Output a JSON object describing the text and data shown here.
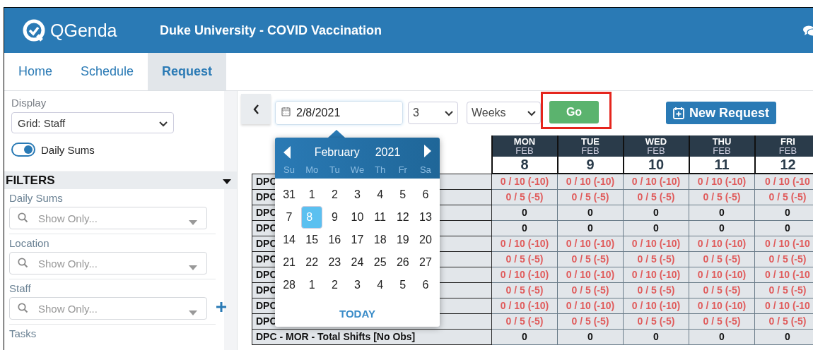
{
  "header": {
    "logo": "QGenda",
    "title": "Duke University - COVID Vaccination"
  },
  "nav": [
    {
      "label": "Home",
      "selected": false
    },
    {
      "label": "Schedule",
      "selected": false
    },
    {
      "label": "Request",
      "selected": true
    }
  ],
  "sidebar": {
    "display_label": "Display",
    "display_value": "Grid: Staff",
    "toggle": {
      "label": "Daily Sums",
      "on": true
    },
    "filters_title": "FILTERS",
    "filters": [
      {
        "label": "Daily Sums",
        "placeholder": "Show Only...",
        "add": false
      },
      {
        "label": "Location",
        "placeholder": "Show Only...",
        "add": false
      },
      {
        "label": "Staff",
        "placeholder": "Show Only...",
        "add": true
      }
    ],
    "tasks_label": "Tasks"
  },
  "toolbar": {
    "date": "2/8/2021",
    "count": "3",
    "unit": "Weeks",
    "go": "Go",
    "go_highlighted": true,
    "new_request": "New Request"
  },
  "grid": {
    "columns": [
      {
        "day": "MON",
        "month": "FEB",
        "date": "8"
      },
      {
        "day": "TUE",
        "month": "FEB",
        "date": "9"
      },
      {
        "day": "WED",
        "month": "FEB",
        "date": "10"
      },
      {
        "day": "THU",
        "month": "FEB",
        "date": "11"
      },
      {
        "day": "FRI",
        "month": "FEB",
        "date": "12"
      }
    ],
    "rows": [
      {
        "label": "DPC",
        "shortage": true,
        "cells": [
          "0 / 10 (-10)",
          "0 / 10 (-10)",
          "0 / 10 (-10)",
          "0 / 10 (-10)",
          "0 / 10 (-10"
        ]
      },
      {
        "label": "DPC",
        "shortage": true,
        "cells": [
          "0 / 5 (-5)",
          "0 / 5 (-5)",
          "0 / 5 (-5)",
          "0 / 5 (-5)",
          "0 / 5 (-5)"
        ]
      },
      {
        "label": "DPC",
        "shortage": false,
        "cells": [
          "0",
          "0",
          "0",
          "0",
          "0"
        ]
      },
      {
        "label": "DPC",
        "shortage": false,
        "cells": [
          "0",
          "0",
          "0",
          "0",
          "0"
        ]
      },
      {
        "label": "DPC",
        "shortage": true,
        "cells": [
          "0 / 10 (-10)",
          "0 / 10 (-10)",
          "0 / 10 (-10)",
          "0 / 10 (-10)",
          "0 / 10 (-10"
        ]
      },
      {
        "label": "DPC",
        "shortage": true,
        "cells": [
          "0 / 5 (-5)",
          "0 / 5 (-5)",
          "0 / 5 (-5)",
          "0 / 5 (-5)",
          "0 / 5 (-5)"
        ]
      },
      {
        "label": "DPC",
        "shortage": true,
        "cells": [
          "0 / 10 (-10)",
          "0 / 10 (-10)",
          "0 / 10 (-10)",
          "0 / 10 (-10)",
          "0 / 10 (-10"
        ]
      },
      {
        "label": "DPC",
        "shortage": true,
        "cells": [
          "0 / 5 (-5)",
          "0 / 5 (-5)",
          "0 / 5 (-5)",
          "0 / 5 (-5)",
          "0 / 5 (-5)"
        ]
      },
      {
        "label": "DPC",
        "shortage": true,
        "cells": [
          "0 / 10 (-10)",
          "0 / 10 (-10)",
          "0 / 10 (-10)",
          "0 / 10 (-10)",
          "0 / 10 (-10"
        ]
      },
      {
        "label": "DPC",
        "shortage": true,
        "cells": [
          "0 / 5 (-5)",
          "0 / 5 (-5)",
          "0 / 5 (-5)",
          "0 / 5 (-5)",
          "0 / 5 (-5)"
        ]
      },
      {
        "label": "DPC - MOR - Total Shifts [No Obs]",
        "shortage": false,
        "cells": [
          "0",
          "0",
          "0",
          "0",
          "0"
        ]
      }
    ]
  },
  "datepicker": {
    "month": "February",
    "year": "2021",
    "weekdays": [
      "Su",
      "Mo",
      "Tu",
      "We",
      "Th",
      "Fr",
      "Sa"
    ],
    "weeks": [
      [
        {
          "label": "31",
          "selected": false
        },
        {
          "label": "1",
          "selected": false
        },
        {
          "label": "2",
          "selected": false
        },
        {
          "label": "3",
          "selected": false
        },
        {
          "label": "4",
          "selected": false
        },
        {
          "label": "5",
          "selected": false
        },
        {
          "label": "6",
          "selected": false
        }
      ],
      [
        {
          "label": "7",
          "selected": false
        },
        {
          "label": "8",
          "selected": true
        },
        {
          "label": "9",
          "selected": false
        },
        {
          "label": "10",
          "selected": false
        },
        {
          "label": "11",
          "selected": false
        },
        {
          "label": "12",
          "selected": false
        },
        {
          "label": "13",
          "selected": false
        }
      ],
      [
        {
          "label": "14",
          "selected": false
        },
        {
          "label": "15",
          "selected": false
        },
        {
          "label": "16",
          "selected": false
        },
        {
          "label": "17",
          "selected": false
        },
        {
          "label": "18",
          "selected": false
        },
        {
          "label": "19",
          "selected": false
        },
        {
          "label": "20",
          "selected": false
        }
      ],
      [
        {
          "label": "21",
          "selected": false
        },
        {
          "label": "22",
          "selected": false
        },
        {
          "label": "23",
          "selected": false
        },
        {
          "label": "24",
          "selected": false
        },
        {
          "label": "25",
          "selected": false
        },
        {
          "label": "26",
          "selected": false
        },
        {
          "label": "27",
          "selected": false
        }
      ],
      [
        {
          "label": "28",
          "selected": false
        },
        {
          "label": "1",
          "selected": false
        },
        {
          "label": "2",
          "selected": false
        },
        {
          "label": "3",
          "selected": false
        },
        {
          "label": "4",
          "selected": false
        },
        {
          "label": "5",
          "selected": false
        },
        {
          "label": "6",
          "selected": false
        }
      ]
    ],
    "today": "TODAY"
  }
}
